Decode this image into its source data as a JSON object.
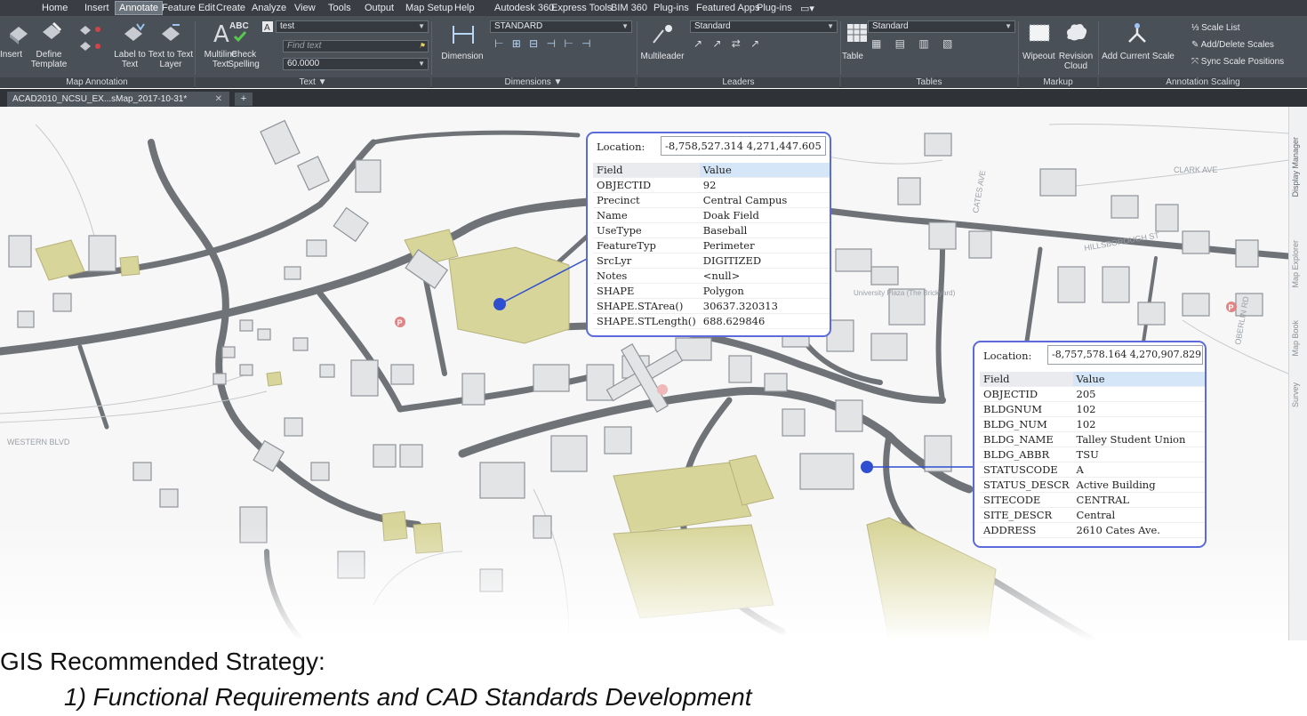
{
  "ribbon_tabs": [
    "Home",
    "Insert",
    "Annotate",
    "Feature Edit",
    "Create",
    "Analyze",
    "View",
    "Tools",
    "Output",
    "Map Setup",
    "Help",
    "Autodesk 360",
    "Express Tools",
    "BIM 360",
    "Plug-ins",
    "Featured Apps",
    "Plug-ins"
  ],
  "active_tab": "Annotate",
  "ribbon": {
    "map_annotation": {
      "title": "Map Annotation",
      "insert_label": "Insert",
      "define_label": "Define Template",
      "label_to_text": "Label to Text",
      "text_to_layer": "Text to Text Layer"
    },
    "text": {
      "title": "Text",
      "multiline_label": "Multiline Text",
      "check_label": "Check Spelling",
      "style_value": "test",
      "find_placeholder": "Find text",
      "height_value": "60.0000",
      "abc": "ABC"
    },
    "dimensions": {
      "title": "Dimensions",
      "dimension_label": "Dimension",
      "style_value": "STANDARD"
    },
    "leaders": {
      "title": "Leaders",
      "multileader_label": "Multileader",
      "style_value": "Standard"
    },
    "tables": {
      "title": "Tables",
      "table_label": "Table",
      "style_value": "Standard"
    },
    "markup": {
      "title": "Markup",
      "wipeout_label": "Wipeout",
      "revision_label": "Revision Cloud"
    },
    "annotation_scaling": {
      "title": "Annotation Scaling",
      "add_scale_label": "Add Current Scale",
      "scale_list_label": "Scale List",
      "add_delete_label": "Add/Delete Scales",
      "sync_label": "Sync Scale Positions"
    }
  },
  "document_tab": "ACAD2010_NCSU_EX...sMap_2017-10-31*",
  "side_panel": {
    "display_manager": "Display Manager",
    "map_explorer": "Map Explorer",
    "map_book": "Map Book",
    "survey": "Survey"
  },
  "map_labels": {
    "clark_ave": "CLARK AVE",
    "hillsborough_st": "HILLSBOROUGH ST",
    "oberlin_rd": "OBERLIN RD",
    "cates_ave": "CATES AVE",
    "western_blvd": "WESTERN BLVD",
    "university_plaza": "University Plaza (The Brickyard)",
    "parking": "P"
  },
  "popup1": {
    "location_label": "Location:",
    "location_value": "-8,758,527.314  4,271,447.605",
    "header": [
      "Field",
      "Value"
    ],
    "rows": [
      [
        "OBJECTID",
        "92"
      ],
      [
        "Precinct",
        "Central Campus"
      ],
      [
        "Name",
        "Doak Field"
      ],
      [
        "UseType",
        "Baseball"
      ],
      [
        "FeatureTyp",
        "Perimeter"
      ],
      [
        "SrcLyr",
        "DIGITIZED"
      ],
      [
        "Notes",
        "<null>"
      ],
      [
        "SHAPE",
        "Polygon"
      ],
      [
        "SHAPE.STArea()",
        "30637.320313"
      ],
      [
        "SHAPE.STLength()",
        "688.629846"
      ]
    ]
  },
  "popup2": {
    "location_label": "Location:",
    "location_value": "-8,757,578.164  4,270,907.829",
    "header": [
      "Field",
      "Value"
    ],
    "rows": [
      [
        "OBJECTID",
        "205"
      ],
      [
        "BLDGNUM",
        "102"
      ],
      [
        "BLDG_NUM",
        "102"
      ],
      [
        "BLDG_NAME",
        "Talley Student Union"
      ],
      [
        "BLDG_ABBR",
        "TSU"
      ],
      [
        "STATUSCODE",
        "A"
      ],
      [
        "STATUS_DESCR",
        "Active Building"
      ],
      [
        "SITECODE",
        "CENTRAL"
      ],
      [
        "SITE_DESCR",
        "Central"
      ],
      [
        "ADDRESS",
        "2610 Cates Ave."
      ]
    ]
  },
  "slide": {
    "heading": "GIS Recommended Strategy:",
    "point": "1) Functional Requirements and CAD Standards Development"
  },
  "colors": {
    "ribbon_bg": "#4a5058",
    "menubar_bg": "#3a3e44",
    "popup_border": "#5b6bdc",
    "road": "#6f7378",
    "building": "#e3e4e6",
    "field": "#d8d59a",
    "pin": "#2f4fd0",
    "parking": "#e08585"
  },
  "icons": [
    "insert-icon",
    "define-template-icon",
    "label-to-text-icon",
    "text-to-layer-icon",
    "multiline-text-icon",
    "check-spelling-icon",
    "dimension-icon",
    "multileader-icon",
    "table-icon",
    "wipeout-icon",
    "revision-cloud-icon",
    "add-current-scale-icon",
    "scale-list-icon",
    "add-delete-scales-icon",
    "sync-scale-icon"
  ]
}
